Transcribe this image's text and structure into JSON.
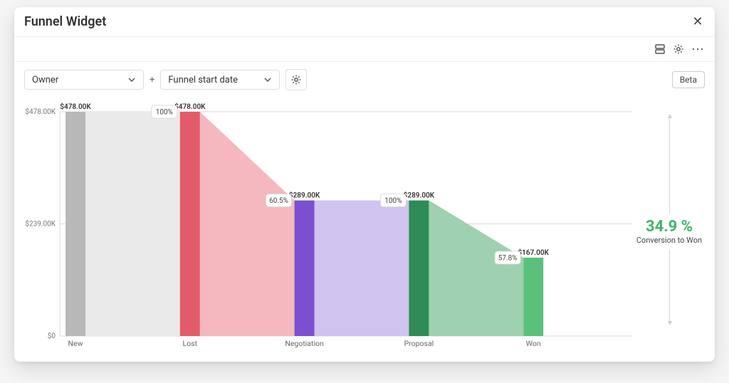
{
  "header": {
    "title": "Funnel Widget",
    "close_icon": "close-icon"
  },
  "subbar": {
    "layout_icon": "layout-icon",
    "settings_icon": "gear-icon",
    "more_icon": "more-icon"
  },
  "filters": {
    "owner_label": "Owner",
    "funnel_start_label": "Funnel start date",
    "join_symbol": "+",
    "config_icon": "gear-icon",
    "beta_badge": "Beta"
  },
  "side_metric": {
    "value": "34.9 %",
    "caption": "Conversion to Won"
  },
  "chart_data": {
    "type": "bar",
    "title": "Funnel Widget",
    "xlabel": "",
    "ylabel": "",
    "ylim": [
      0,
      478
    ],
    "categories": [
      "New",
      "Lost",
      "Negotiation",
      "Proposal",
      "Won"
    ],
    "values": [
      478,
      478,
      289,
      289,
      167
    ],
    "value_labels": [
      "$478.00K",
      "$478.00K",
      "$289.00K",
      "$289.00K",
      "$167.00K"
    ],
    "conversion_labels": [
      "",
      "100%",
      "60.5%",
      "100%",
      "57.8%"
    ],
    "y_ticks": [
      {
        "v": 0,
        "label": "$0"
      },
      {
        "v": 239,
        "label": "$239.00K"
      },
      {
        "v": 478,
        "label": "$478.00K"
      }
    ],
    "bar_colors": [
      "#b8b8b8",
      "#e35b6a",
      "#7b4fcf",
      "#2e8b57",
      "#5bc17a"
    ],
    "connector_colors": [
      "#eaeaea",
      "#f4b8be",
      "#cfc3ef",
      "#9fd0af",
      ""
    ]
  }
}
